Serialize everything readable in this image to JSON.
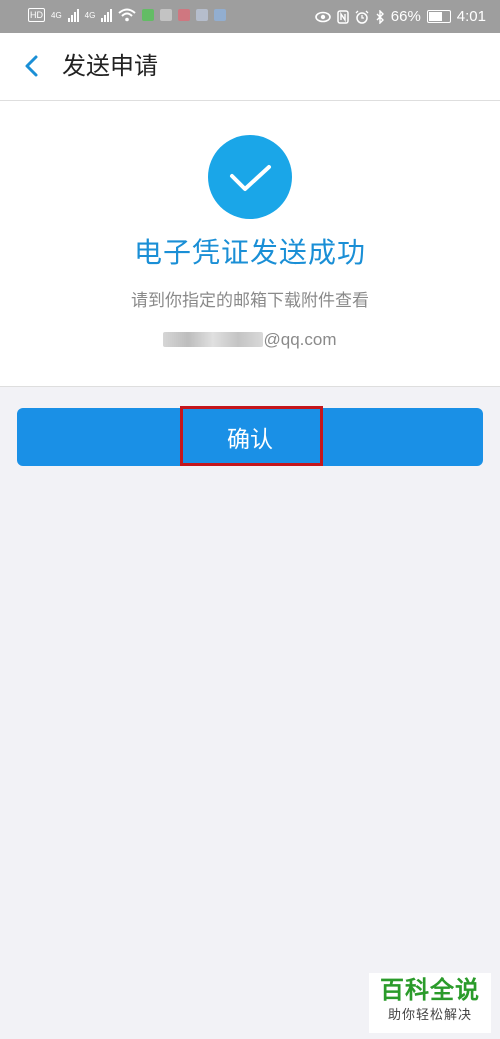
{
  "status_bar": {
    "hd": "HD",
    "net1": "4G",
    "net2": "4G",
    "battery_pct": "66%",
    "time": "4:01",
    "icons": [
      "eye-icon",
      "nfc-icon",
      "alarm-icon",
      "bluetooth-icon",
      "battery-icon"
    ]
  },
  "header": {
    "title": "发送申请"
  },
  "result": {
    "title": "电子凭证发送成功",
    "hint": "请到你指定的邮箱下载附件查看",
    "email_suffix": "@qq.com"
  },
  "confirm_button": {
    "label": "确认"
  },
  "watermark": {
    "title": "百科全说",
    "subtitle": "助你轻松解决"
  },
  "colors": {
    "accent": "#1a90e6",
    "check_circle": "#1aa6e8",
    "title_blue": "#1a8fd6",
    "highlight_red": "#c4161c",
    "watermark_green": "#2a9b2a"
  }
}
